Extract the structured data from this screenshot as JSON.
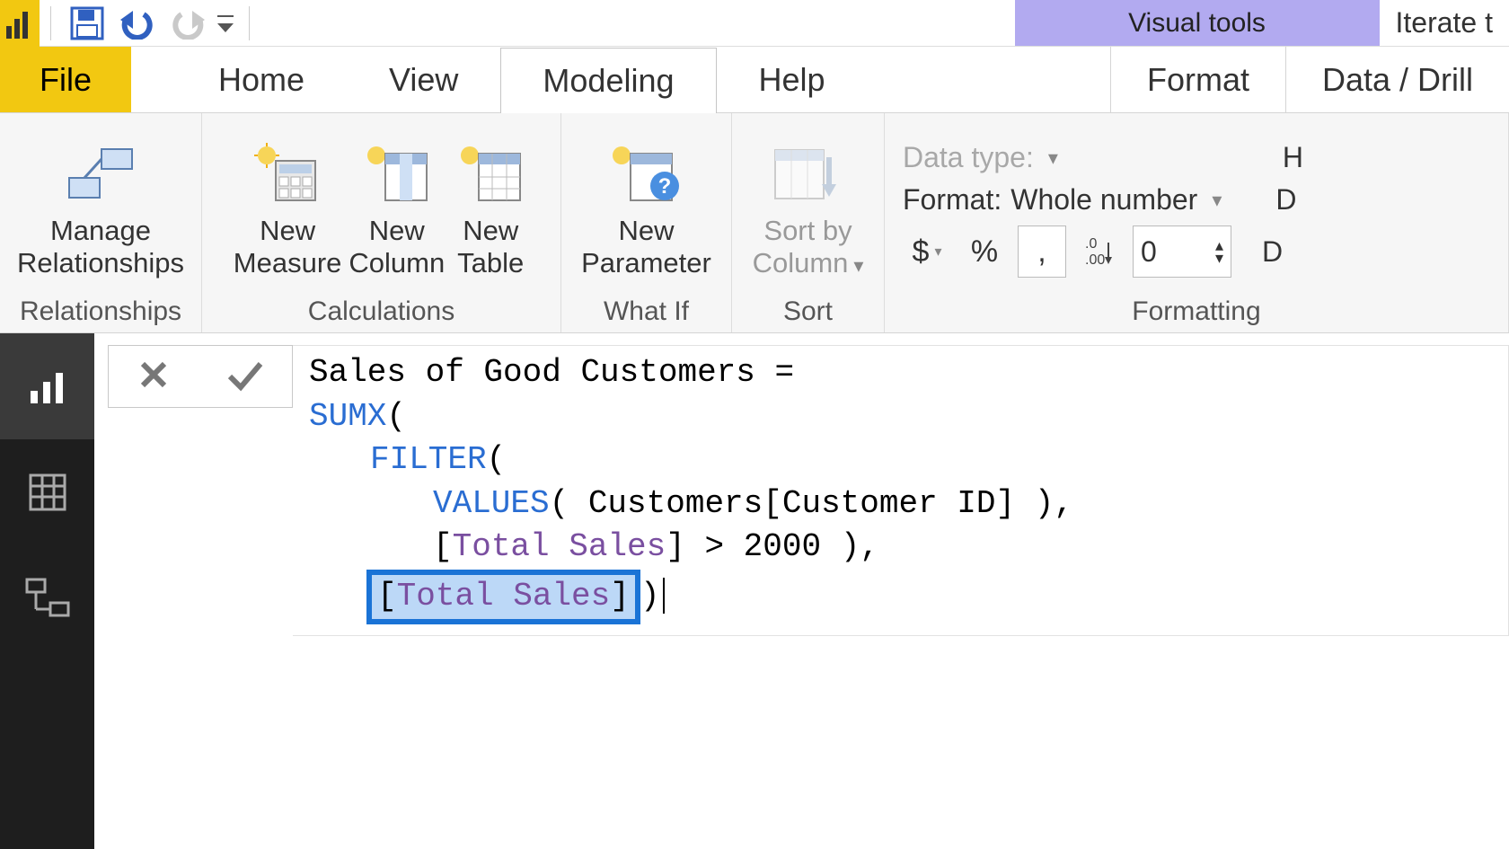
{
  "titlebar": {
    "visual_tools": "Visual tools",
    "right_text": "Iterate t"
  },
  "tabs": {
    "file": "File",
    "home": "Home",
    "view": "View",
    "modeling": "Modeling",
    "help": "Help",
    "format": "Format",
    "data_drill": "Data / Drill"
  },
  "ribbon": {
    "relationships": {
      "group": "Relationships",
      "manage_l1": "Manage",
      "manage_l2": "Relationships"
    },
    "calculations": {
      "group": "Calculations",
      "new_measure_l1": "New",
      "new_measure_l2": "Measure",
      "new_column_l1": "New",
      "new_column_l2": "Column",
      "new_table_l1": "New",
      "new_table_l2": "Table"
    },
    "whatif": {
      "group": "What If",
      "new_param_l1": "New",
      "new_param_l2": "Parameter"
    },
    "sort": {
      "group": "Sort",
      "sort_by_l1": "Sort by",
      "sort_by_l2": "Column"
    },
    "formatting": {
      "group": "Formatting",
      "datatype_label": "Data type:",
      "format_label": "Format:",
      "format_value": "Whole number",
      "currency": "$",
      "percent": "%",
      "thousands": ",",
      "precision": ".00",
      "decimals": "0",
      "h_cut": "H",
      "d_cut": "D",
      "d_cut2": "D"
    }
  },
  "formula": {
    "line1_pre": "Sales of Good Customers = ",
    "sumx": "SUMX",
    "paren_o": "(",
    "filter": "FILTER",
    "values": "VALUES",
    "values_arg": "( Customers[Customer ID] ),",
    "ref_total_sales": "Total Sales",
    "bracket_o": "[",
    "bracket_c": "]",
    "cond_rest": " > 2000 ),",
    "last_paren": ")"
  },
  "canvas": {
    "bgtext": "Iter"
  }
}
